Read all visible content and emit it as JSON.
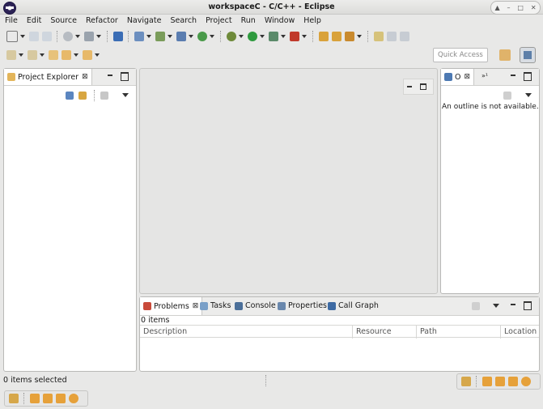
{
  "window": {
    "title": "workspaceC - C/C++ - Eclipse"
  },
  "menu": [
    "File",
    "Edit",
    "Source",
    "Refactor",
    "Navigate",
    "Search",
    "Project",
    "Run",
    "Window",
    "Help"
  ],
  "quick_access": {
    "placeholder": "Quick Access"
  },
  "project_explorer": {
    "tab_label": "Project Explorer"
  },
  "outline": {
    "tab_label": "O",
    "message": "An outline is not available.",
    "chevron_count": "»¹"
  },
  "bottom": {
    "tabs": [
      {
        "label": "Problems",
        "icon": "problems-icon"
      },
      {
        "label": "Tasks",
        "icon": "tasks-icon"
      },
      {
        "label": "Console",
        "icon": "console-icon"
      },
      {
        "label": "Properties",
        "icon": "properties-icon"
      },
      {
        "label": "Call Graph",
        "icon": "call-graph-icon"
      }
    ],
    "items_count": "0 items",
    "columns": [
      "Description",
      "Resource",
      "Path",
      "Location"
    ]
  },
  "status": {
    "text": "0 items selected"
  },
  "colors": {
    "accent": "#e6a13a",
    "title_bar": "#dcdcda",
    "panel_border": "#b9b9b7"
  }
}
